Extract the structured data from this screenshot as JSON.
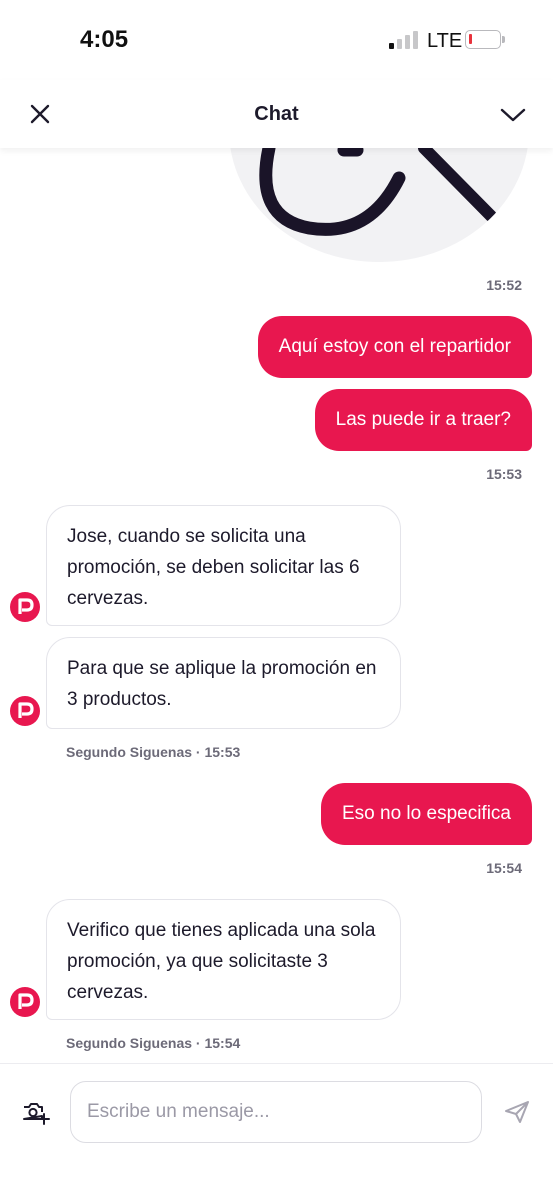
{
  "status_bar": {
    "time": "4:05",
    "network": "LTE",
    "battery_level": 0.1,
    "signal_icon": "signal-bars-icon",
    "battery_icon": "battery-low-icon"
  },
  "header": {
    "title": "Chat",
    "close_icon": "close-icon",
    "collapse_icon": "chevron-down-icon"
  },
  "messages": {
    "image_time": "15:52",
    "out_group_1": {
      "texts": [
        "Aquí estoy con el repartidor",
        "Las puede ir a traer?"
      ],
      "time": "15:53"
    },
    "in_group_1": {
      "texts": [
        "Jose, cuando se solicita una promoción, se deben solicitar las 6 cervezas.",
        "Para que se aplique la promoción en 3 productos."
      ],
      "meta": "Segundo Siguenas · 15:53"
    },
    "out_group_2": {
      "texts": [
        "Eso no lo especifica"
      ],
      "time": "15:54"
    },
    "in_group_2": {
      "texts": [
        "Verifico que tienes aplicada una sola promoción, ya que solicitaste 3 cervezas."
      ],
      "meta": "Segundo Siguenas · 15:54"
    }
  },
  "composer": {
    "placeholder": "Escribe un mensaje...",
    "value": "",
    "camera_icon": "camera-add-icon",
    "send_icon": "send-icon"
  },
  "colors": {
    "accent": "#e8174f",
    "agent_avatar": "#e8174f",
    "text_dark": "#1d1a2b",
    "meta_gray": "#6c6a78"
  }
}
